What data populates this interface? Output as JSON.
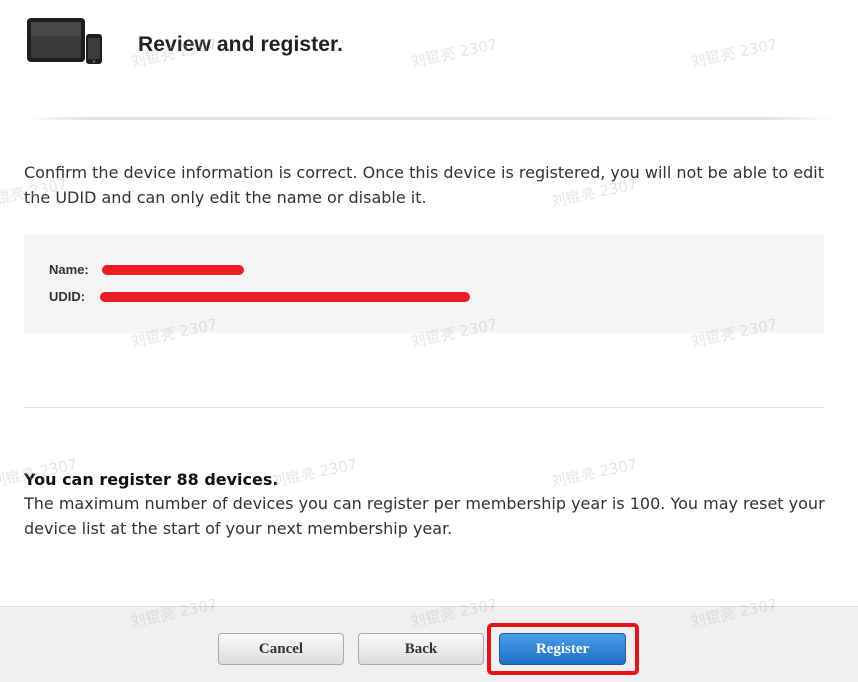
{
  "header": {
    "title": "Review and register.",
    "icon": "ipad-iphone-devices-icon"
  },
  "intro": {
    "text": "Confirm the device information is correct. Once this device is registered, you will not be able to edit the UDID and can only edit the name or disable it."
  },
  "device_info": {
    "name_label": "Name:",
    "udid_label": "UDID:",
    "redaction_color": "#ec1c24"
  },
  "limit": {
    "heading": "You can register 88 devices.",
    "text": "The maximum number of devices you can register per membership year is 100. You may reset your device list at the start of your next membership year."
  },
  "footer": {
    "cancel_label": "Cancel",
    "back_label": "Back",
    "register_label": "Register",
    "highlight_color": "#e8121b",
    "primary_color": "#1e6fc7"
  },
  "watermark": {
    "text": "刘锟亮 2307"
  }
}
